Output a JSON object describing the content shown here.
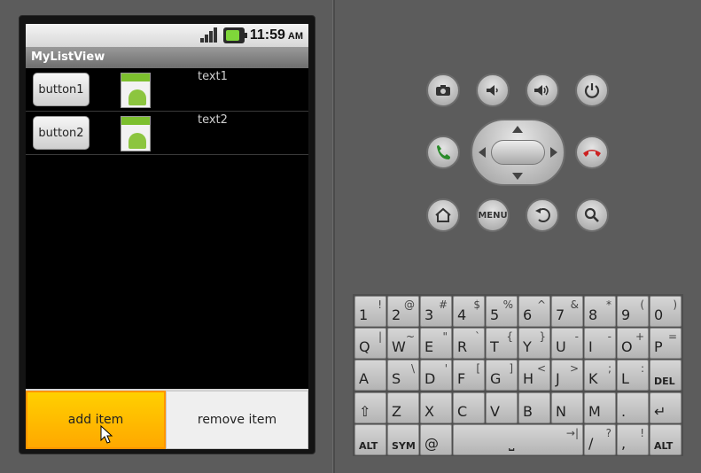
{
  "status_bar": {
    "time": "11:59",
    "ampm": "AM"
  },
  "app": {
    "title": "MyListView"
  },
  "list": {
    "items": [
      {
        "button_label": "button1",
        "text": "text1"
      },
      {
        "button_label": "button2",
        "text": "text2"
      }
    ]
  },
  "actions": {
    "add_label": "add item",
    "remove_label": "remove item"
  },
  "controls": {
    "buttons": [
      "camera-icon",
      "volume-down-icon",
      "volume-up-icon",
      "power-icon",
      "call-icon",
      "end-call-icon",
      "home-icon",
      "menu",
      "back-icon",
      "search-icon"
    ],
    "menu_label": "MENU"
  },
  "keyboard": {
    "rows": [
      [
        {
          "m": "1",
          "a": "!"
        },
        {
          "m": "2",
          "a": "@"
        },
        {
          "m": "3",
          "a": "#"
        },
        {
          "m": "4",
          "a": "$"
        },
        {
          "m": "5",
          "a": "%"
        },
        {
          "m": "6",
          "a": "^"
        },
        {
          "m": "7",
          "a": "&"
        },
        {
          "m": "8",
          "a": "*"
        },
        {
          "m": "9",
          "a": "("
        },
        {
          "m": "0",
          "a": ")"
        }
      ],
      [
        {
          "m": "Q",
          "a": "|"
        },
        {
          "m": "W",
          "a": "~"
        },
        {
          "m": "E",
          "a": "\""
        },
        {
          "m": "R",
          "a": "`"
        },
        {
          "m": "T",
          "a": "{"
        },
        {
          "m": "Y",
          "a": "}"
        },
        {
          "m": "U",
          "a": "-"
        },
        {
          "m": "I",
          "a": "-"
        },
        {
          "m": "O",
          "a": "+"
        },
        {
          "m": "P",
          "a": "="
        }
      ],
      [
        {
          "m": "A",
          "a": ""
        },
        {
          "m": "S",
          "a": "\\"
        },
        {
          "m": "D",
          "a": "'"
        },
        {
          "m": "F",
          "a": "["
        },
        {
          "m": "G",
          "a": "]"
        },
        {
          "m": "H",
          "a": "<"
        },
        {
          "m": "J",
          "a": ">"
        },
        {
          "m": "K",
          "a": ";"
        },
        {
          "m": "L",
          "a": ":"
        },
        {
          "m": "DEL",
          "a": ""
        }
      ],
      [
        {
          "m": "⇧",
          "a": ""
        },
        {
          "m": "Z",
          "a": ""
        },
        {
          "m": "X",
          "a": ""
        },
        {
          "m": "C",
          "a": ""
        },
        {
          "m": "V",
          "a": ""
        },
        {
          "m": "B",
          "a": ""
        },
        {
          "m": "N",
          "a": ""
        },
        {
          "m": "M",
          "a": ""
        },
        {
          "m": ".",
          "a": ""
        },
        {
          "m": "↵",
          "a": ""
        }
      ],
      [
        {
          "m": "ALT",
          "a": ""
        },
        {
          "m": "SYM",
          "a": ""
        },
        {
          "m": "@",
          "a": ""
        },
        {
          "m": "␣",
          "a": ""
        },
        {
          "m": "/",
          "a": "?"
        },
        {
          "m": ",",
          "a": "!"
        },
        {
          "m": "ALT",
          "a": ""
        }
      ]
    ]
  }
}
